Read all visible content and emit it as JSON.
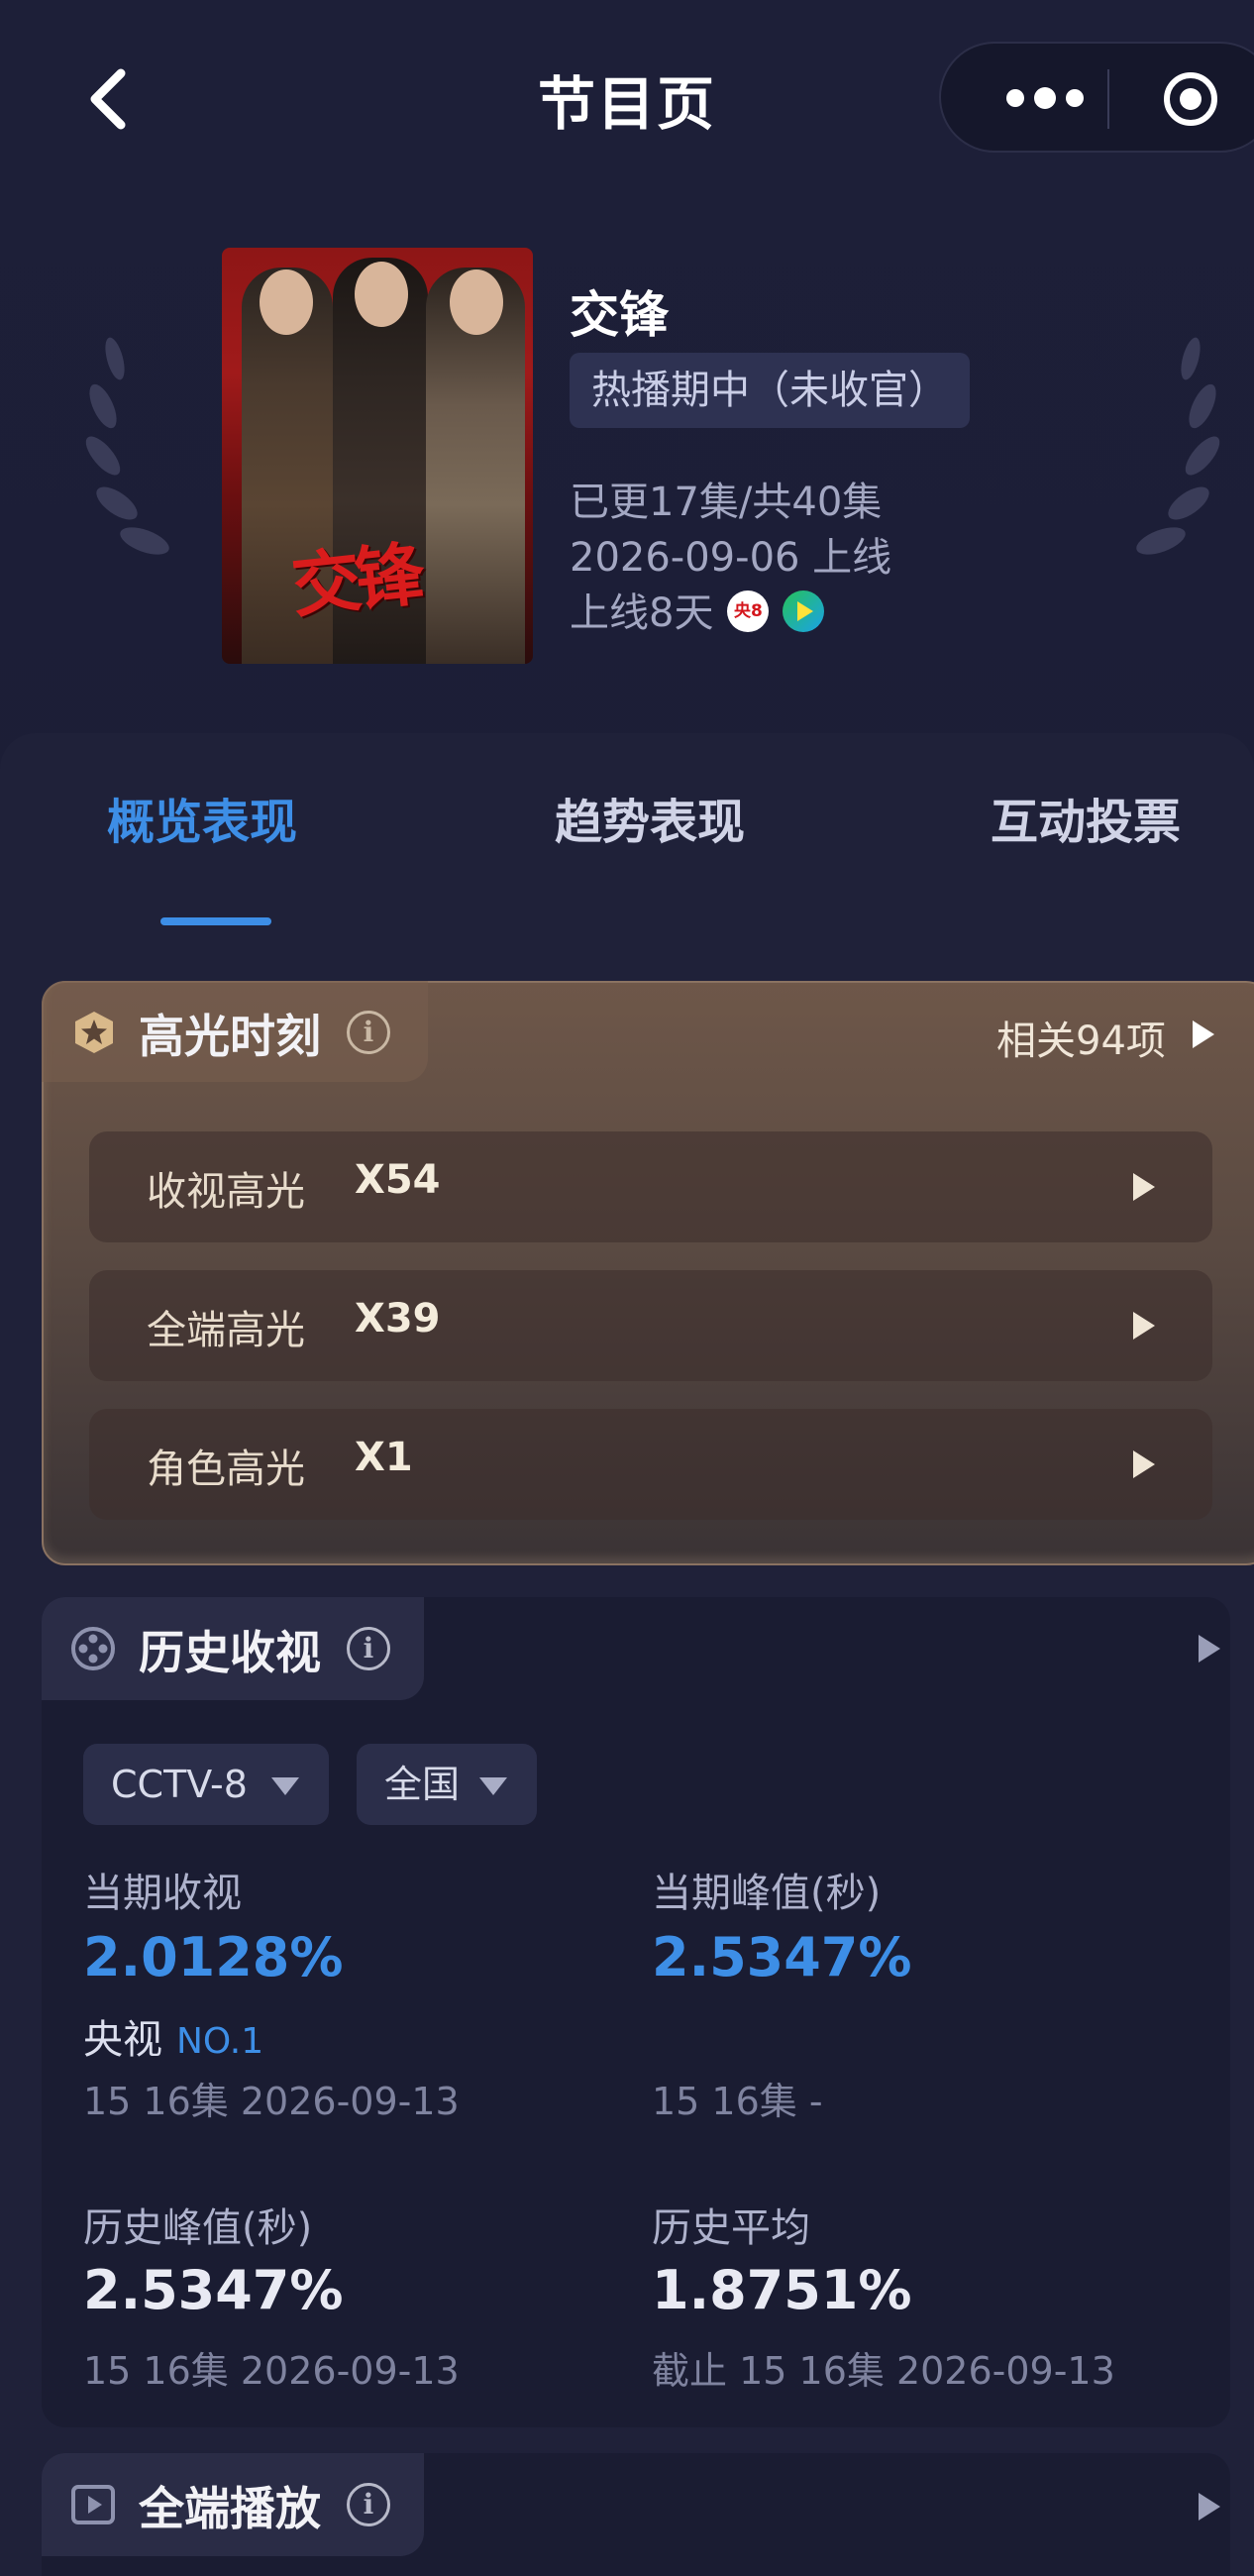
{
  "header": {
    "title": "节目页",
    "back_icon": "chevron-left-icon",
    "more_icon": "more-dots-icon",
    "target_icon": "target-icon"
  },
  "show": {
    "name": "交锋",
    "status": "热播期中（未收官）",
    "episodes": "已更17集/共40集",
    "release": "2026-09-06 上线",
    "days_online": "上线8天",
    "channel_badge": "央8",
    "poster_title": "交锋"
  },
  "tabs": [
    {
      "label": "概览表现",
      "active": true
    },
    {
      "label": "趋势表现",
      "active": false
    },
    {
      "label": "互动投票",
      "active": false
    }
  ],
  "highlights": {
    "title": "高光时刻",
    "related": "相关94项",
    "rows": [
      {
        "label": "收视高光",
        "value": "X54"
      },
      {
        "label": "全端高光",
        "value": "X39"
      },
      {
        "label": "角色高光",
        "value": "X1"
      }
    ]
  },
  "history": {
    "title": "历史收视",
    "filters": {
      "channel": "CCTV-8",
      "region": "全国"
    },
    "current_rating": {
      "label": "当期收视",
      "value": "2.0128%",
      "rank_prefix": "央视",
      "rank": "NO.1",
      "sub": "15 16集  2026-09-13"
    },
    "current_peak": {
      "label": "当期峰值(秒)",
      "value": "2.5347%",
      "sub": "15 16集  -"
    },
    "history_peak": {
      "label": "历史峰值(秒)",
      "value": "2.5347%",
      "sub": "15 16集  2026-09-13"
    },
    "history_avg": {
      "label": "历史平均",
      "value": "1.8751%",
      "sub": "截止 15 16集  2026-09-13"
    }
  },
  "all_platform": {
    "title": "全端播放"
  },
  "colors": {
    "accent": "#3d8ee6",
    "background": "#1c1e36",
    "highlight_card": "#5a4a42"
  }
}
